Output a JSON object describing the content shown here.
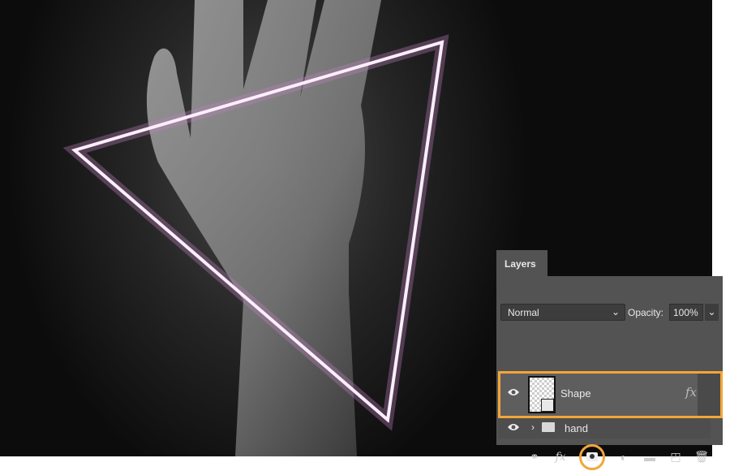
{
  "panel": {
    "tab": "Layers",
    "blend_mode": "Normal",
    "opacity_label": "Opacity:",
    "opacity_value": "100%"
  },
  "layers": [
    {
      "name": "Shape",
      "has_fx": true,
      "fx_label": "fx",
      "selected": true
    },
    {
      "name": "hand",
      "type": "group"
    }
  ],
  "footer_icons": [
    "link-icon",
    "fx-icon",
    "add-mask-icon",
    "adjustment-icon",
    "folder-icon",
    "new-layer-icon",
    "trash-icon"
  ],
  "colors": {
    "highlight": "#f3a637",
    "triangle_glow": "#e8a0e0"
  }
}
